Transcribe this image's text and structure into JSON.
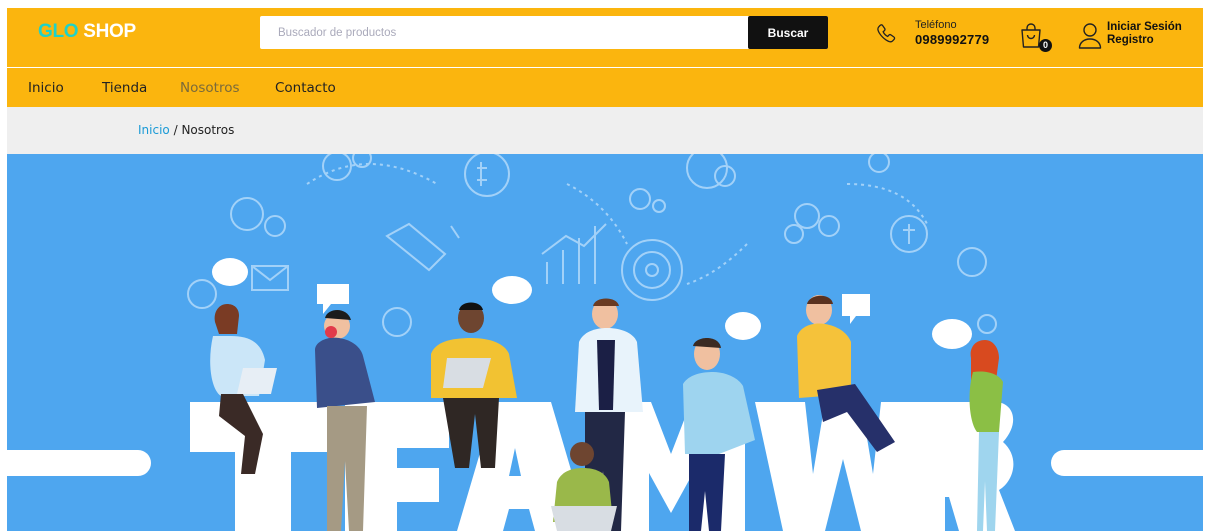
{
  "header": {
    "logo_part1": "GLO",
    "logo_part2": "SHOP",
    "search_placeholder": "Buscador de productos",
    "search_button": "Buscar",
    "phone_label": "Teléfono",
    "phone_number": "0989992779",
    "cart_count": "0",
    "login_label": "Iniciar Sesión",
    "register_label": "Registro"
  },
  "nav": {
    "items": [
      {
        "label": "Inicio"
      },
      {
        "label": "Tienda"
      },
      {
        "label": "Nosotros"
      },
      {
        "label": "Contacto"
      }
    ],
    "active": "Nosotros"
  },
  "breadcrumb": {
    "home": "Inicio",
    "separator": " / ",
    "current": "Nosotros"
  },
  "hero": {
    "image_text": "TEAMWORK"
  },
  "colors": {
    "brand_yellow": "#fbb50e",
    "logo_teal": "#1fd2c8",
    "hero_blue": "#4ea6ef",
    "link_blue": "#1a9ad6"
  }
}
